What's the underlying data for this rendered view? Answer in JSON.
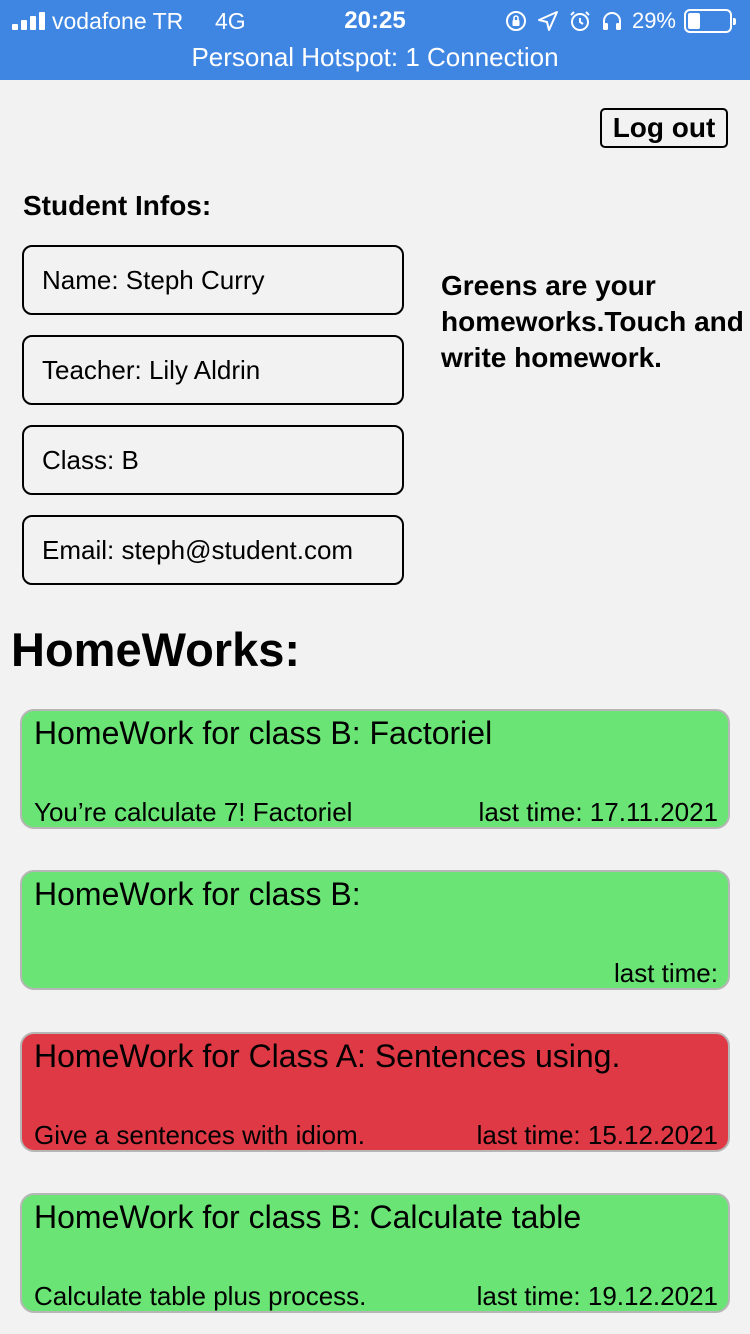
{
  "status_bar": {
    "carrier": "vodafone TR",
    "network": "4G",
    "time": "20:25",
    "battery": "29%",
    "battery_level": 0.29,
    "hotspot": "Personal Hotspot: 1 Connection",
    "background_color": "#3f86e3"
  },
  "header": {
    "logout_label": "Log out"
  },
  "student": {
    "section_title": "Student Infos:",
    "name": "Name: Steph Curry",
    "teacher": "Teacher: Lily Aldrin",
    "class": "Class: B",
    "email": "Email: steph@student.com"
  },
  "hint": "Greens are your homeworks.Touch and write homework.",
  "homeworks": {
    "title": "HomeWorks:",
    "items": [
      {
        "title": "HomeWork for class B: Factoriel",
        "description": "You’re calculate 7! Factoriel",
        "due": "last time: 17.11.2021",
        "status": "green"
      },
      {
        "title": "HomeWork for class B:",
        "description": "",
        "due": "last time:",
        "status": "green"
      },
      {
        "title": "HomeWork for Class A: Sentences using.",
        "description": "Give a sentences with idiom.",
        "due": "last time: 15.12.2021",
        "status": "red"
      },
      {
        "title": "HomeWork for class B: Calculate table",
        "description": "Calculate table plus process.",
        "due": "last time: 19.12.2021",
        "status": "green"
      }
    ]
  },
  "colors": {
    "green_card": "#6ae474",
    "red_card": "#df3945",
    "page_background": "#f2f2f2"
  },
  "icons": [
    "signal-icon",
    "orientation-lock-icon",
    "location-icon",
    "alarm-icon",
    "headphones-icon",
    "battery-icon"
  ]
}
